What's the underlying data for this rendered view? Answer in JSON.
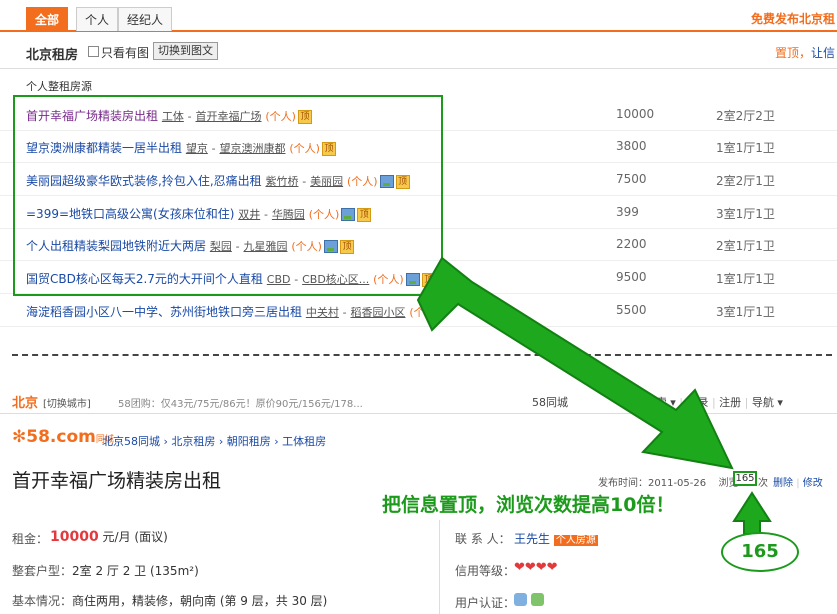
{
  "tabs": [
    {
      "label": "全部"
    },
    {
      "label": "个人"
    },
    {
      "label": "经纪人"
    }
  ],
  "publish_text": "免费发布北京租",
  "city_title": "北京租房",
  "only_images_label": "只看有图",
  "switch_view_label": "切换到图文",
  "top_right": {
    "pin": "置顶",
    "sep": "，",
    "more": "让信"
  },
  "section_label": "个人整租房源",
  "listings": [
    {
      "title": "首开幸福广场精装房出租",
      "area": "工体",
      "community": "首开幸福广场",
      "tag": "(个人)",
      "ding": "顶",
      "has_pic": false,
      "price": "10000",
      "layout": "2室2厅2卫",
      "visited": true
    },
    {
      "title": "望京澳洲康都精装一居半出租",
      "area": "望京",
      "community": "望京澳洲康都",
      "tag": "(个人)",
      "ding": "顶",
      "has_pic": false,
      "price": "3800",
      "layout": "1室1厅1卫",
      "visited": false
    },
    {
      "title": "美丽园超级豪华欧式装修,拎包入住,忍痛出租",
      "area": "紫竹桥",
      "community": "美丽园",
      "tag": "(个人)",
      "ding": "顶",
      "has_pic": true,
      "price": "7500",
      "layout": "2室2厅1卫",
      "visited": false
    },
    {
      "title": "=399=地铁口高级公寓(女孩床位和住)",
      "area": "双井",
      "community": "华腾园",
      "tag": "(个人)",
      "ding": "顶",
      "has_pic": true,
      "price": "399",
      "layout": "3室1厅1卫",
      "visited": false
    },
    {
      "title": "个人出租精装梨园地铁附近大两居",
      "area": "梨园",
      "community": "九星雅园",
      "tag": "(个人)",
      "ding": "顶",
      "has_pic": true,
      "price": "2200",
      "layout": "2室1厅1卫",
      "visited": false
    },
    {
      "title": "国贸CBD核心区每天2.7元的大开间个人直租",
      "area": "CBD",
      "community": "CBD核心区...",
      "tag": "(个人)",
      "ding": "顶",
      "has_pic": true,
      "price": "9500",
      "layout": "1室1厅1卫",
      "visited": false
    },
    {
      "title": "海淀稻香园小区八一中学、苏州街地铁口旁三居出租",
      "area": "中关村",
      "community": "稻香园小区",
      "tag": "(个人)",
      "ding": "",
      "has_pic": false,
      "price": "5500",
      "layout": "3室1厅1卫",
      "visited": false
    }
  ],
  "lower": {
    "city": "北京",
    "switch_city": "[切换城市]",
    "promo": "58团购：仅43元/75元/86元！原价90元/156元/178...",
    "nav": {
      "site": "58同城",
      "search": "搜索",
      "login": "登录",
      "register": "注册",
      "guide": "导航"
    },
    "logo_text": "58.com",
    "logo_cn": "同城",
    "breadcrumb": "北京58同城 › 北京租房 › 朝阳租房 › 工体租房",
    "post_title": "首开幸福广场精装房出租",
    "publish_time_label": "发布时间：2011-05-26",
    "views_label": "浏览",
    "views_count": "165",
    "views_unit": "次",
    "delete_label": "删除",
    "edit_label": "修改",
    "rent_label": "租金：",
    "rent_value": "10000",
    "rent_unit": "元/月 (面议)",
    "layout_label": "整套户型：",
    "layout_value": "2室 2 厅 2 卫 (135m²)",
    "basic_label": "基本情况：",
    "basic_value": "商住两用，精装修，朝向南 (第 9 层，共 30 层)",
    "contact_label": "联 系 人：",
    "contact_name": "王先生",
    "contact_badge": "个人房源",
    "credit_label": "信用等级：",
    "credit_hearts": "❤❤❤❤",
    "auth_label": "用户认证："
  },
  "annotation": {
    "promo_text": "把信息置顶，浏览次数提高10倍！",
    "bubble_value": "165"
  },
  "colors": {
    "brand_orange": "#f26d1d",
    "link_blue": "#1a4aa5",
    "highlight_green": "#1c9a1c"
  }
}
